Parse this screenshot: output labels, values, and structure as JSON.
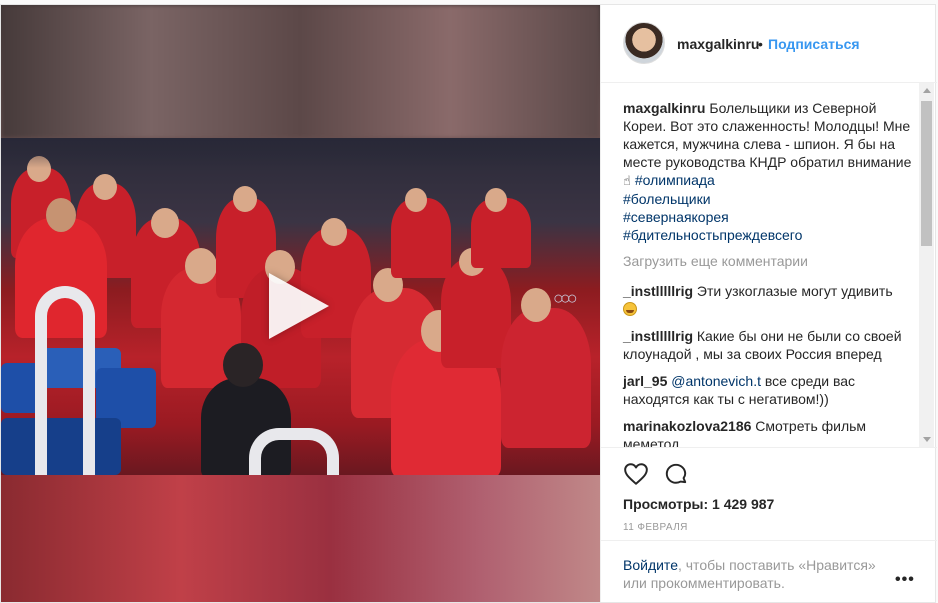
{
  "post": {
    "author": "maxgalkinru",
    "separator": "•",
    "follow_label": "Подписаться",
    "caption": {
      "user": "maxgalkinru",
      "text": "Болельщики из Северной Кореи. Вот это слаженность! Молодцы! Мне кажется, мужчина слева - шпион. Я бы на месте руководства КНДР обратил внимание",
      "hashtags": [
        "#олимпиада",
        "#болельщики",
        "#севернаякорея",
        "#бдительностьпреждевсего"
      ]
    },
    "load_more": "Загрузить еще комментарии",
    "comments": [
      {
        "user": "_instlllllrig",
        "text": "Эти узкоглазые могут удивить"
      },
      {
        "user": "_instlllllrig",
        "text": "Какие бы они не были со своей клоунадой , мы за своих Россия вперед"
      },
      {
        "user": "jarl_95",
        "mention": "@antonevich.t",
        "text": " все среди вас находятся как ты с негативом!))"
      },
      {
        "user": "marinakozlova2186",
        "text": "Смотреть фильм меметод"
      }
    ],
    "views_label": "Просмотры: 1 429 987",
    "date": "11 февраля",
    "login_link": "Войдите",
    "login_text": ", чтобы поставить «Нравится» или прокомментировать.",
    "more_label": "•••",
    "rings": "○○○"
  },
  "icons": {
    "play": "play-icon",
    "heart": "heart-icon",
    "comment": "comment-icon",
    "more": "more-options-icon"
  }
}
